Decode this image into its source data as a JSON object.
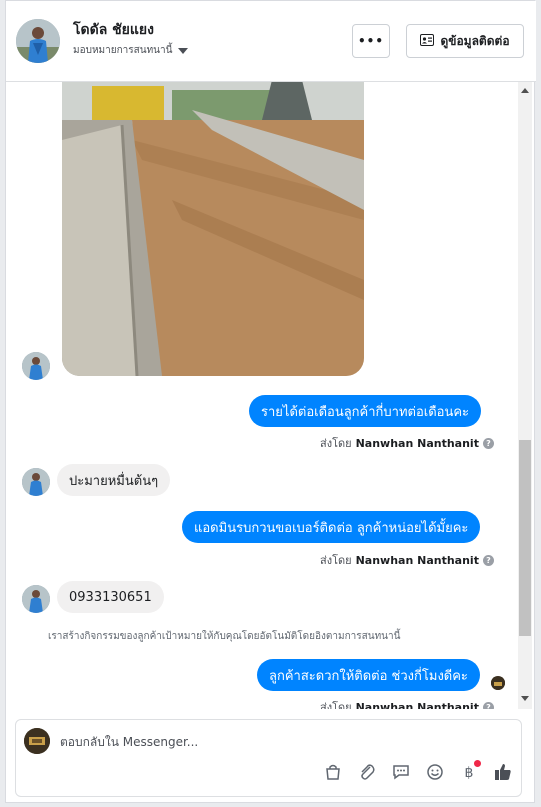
{
  "header": {
    "name": "โดดัล ชัยแยง",
    "assign_label": "มอบหมายการสนทนานี้",
    "more_label": "•••",
    "contact_label": "ดูข้อมูลติดต่อ"
  },
  "messages": {
    "outgoing_1": "รายได้ต่อเดือนลูกค้ากี่บาทต่อเดือนคะ",
    "sent_by_prefix": "ส่งโดย",
    "sender": "Nanwhan Nanthanit",
    "help_glyph": "?",
    "incoming_1": "ปะมายหมื่นต้นๆ",
    "outgoing_2": "แอดมินรบกวนขอเบอร์ติดต่อ ลูกค้าหน่อยได้มั้ยคะ",
    "incoming_2": "0933130651",
    "notice": "เราสร้างกิจกรรมของลูกค้าเป้าหมายให้กับคุณโดยอัตโนมัติโดยอิงตามการสนทนานี้",
    "outgoing_3": "ลูกค้าสะดวกให้ติดต่อ ช่วงกี่โมงดีคะ"
  },
  "composer": {
    "placeholder": "ตอบกลับใน Messenger...",
    "tools": [
      "bag-icon",
      "paperclip-icon",
      "saved-reply-icon",
      "emoji-icon",
      "baht-icon",
      "like-icon"
    ],
    "notification_color": "#f02849"
  },
  "colors": {
    "outgoing_bubble": "#0084ff",
    "incoming_bubble": "#f1f0f0"
  }
}
